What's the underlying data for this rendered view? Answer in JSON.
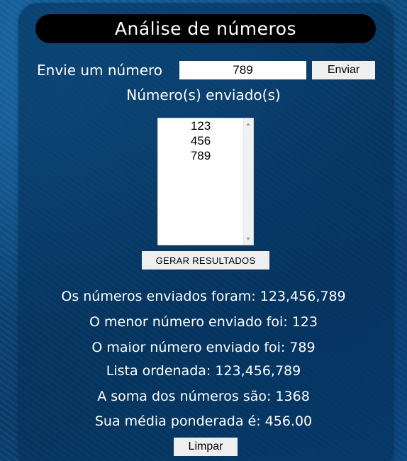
{
  "title": "Análise de números",
  "form": {
    "send_label": "Envie um número",
    "input_value": "789",
    "send_button": "Enviar"
  },
  "sent_heading": "Número(s) enviado(s)",
  "sent_list": [
    "123",
    "456",
    "789"
  ],
  "generate_button": "GERAR RESULTADOS",
  "results": {
    "all_numbers": "Os números enviados foram: 123,456,789",
    "smallest": "O menor número enviado foi: 123",
    "largest": "O maior número enviado foi: 789",
    "sorted": "Lista ordenada: 123,456,789",
    "sum": "A soma dos números são: 1368",
    "average": "Sua média ponderada é: 456.00"
  },
  "clear_button": "Limpar"
}
